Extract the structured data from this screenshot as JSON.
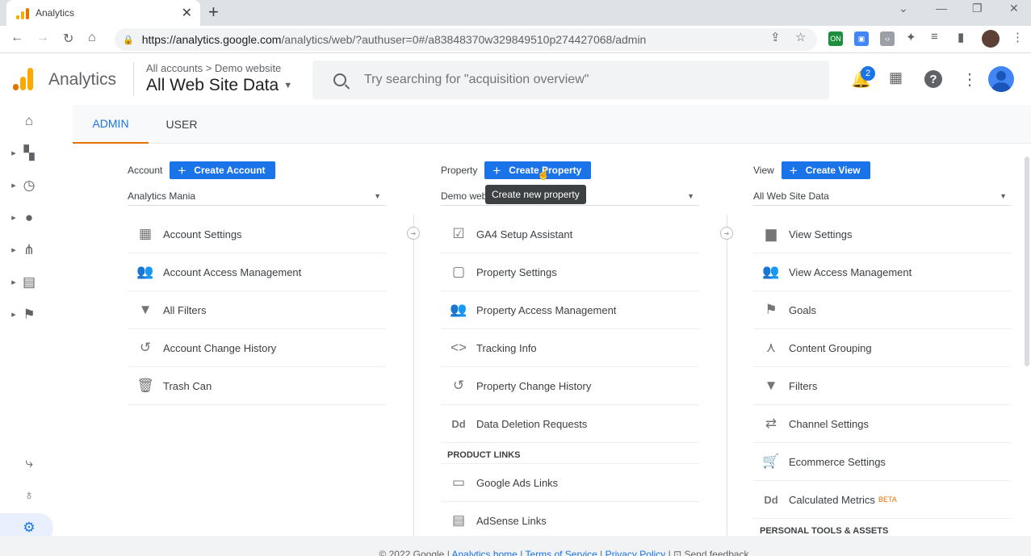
{
  "browser": {
    "tab_title": "Analytics",
    "url_host": "https://analytics.google.com",
    "url_path": "/analytics/web/?authuser=0#/a83848370w329849510p274427068/admin",
    "ext_on": "ON"
  },
  "header": {
    "app_name": "Analytics",
    "crumb_all": "All accounts",
    "crumb_site": "Demo website",
    "view_name": "All Web Site Data",
    "search_placeholder": "Try searching for \"acquisition overview\"",
    "notif_count": "2"
  },
  "tabs": {
    "admin": "ADMIN",
    "user": "USER"
  },
  "account": {
    "label": "Account",
    "create": "Create Account",
    "selected": "Analytics Mania",
    "items": [
      "Account Settings",
      "Account Access Management",
      "All Filters",
      "Account Change History",
      "Trash Can"
    ]
  },
  "property": {
    "label": "Property",
    "create": "Create Property",
    "selected": "Demo webs",
    "tooltip": "Create new property",
    "items": [
      "GA4 Setup Assistant",
      "Property Settings",
      "Property Access Management",
      "Tracking Info",
      "Property Change History",
      "Data Deletion Requests"
    ],
    "links_heading": "PRODUCT LINKS",
    "links": [
      "Google Ads Links",
      "AdSense Links"
    ]
  },
  "view": {
    "label": "View",
    "create": "Create View",
    "selected": "All Web Site Data",
    "items": [
      "View Settings",
      "View Access Management",
      "Goals",
      "Content Grouping",
      "Filters",
      "Channel Settings",
      "Ecommerce Settings",
      "Calculated Metrics"
    ],
    "beta": "BETA",
    "personal_heading": "PERSONAL TOOLS & ASSETS"
  },
  "footer": {
    "copyright": "© 2022 Google |",
    "analytics_home": "Analytics home",
    "terms": "Terms of Service",
    "privacy": "Privacy Policy",
    "feedback": "Send feedback"
  }
}
